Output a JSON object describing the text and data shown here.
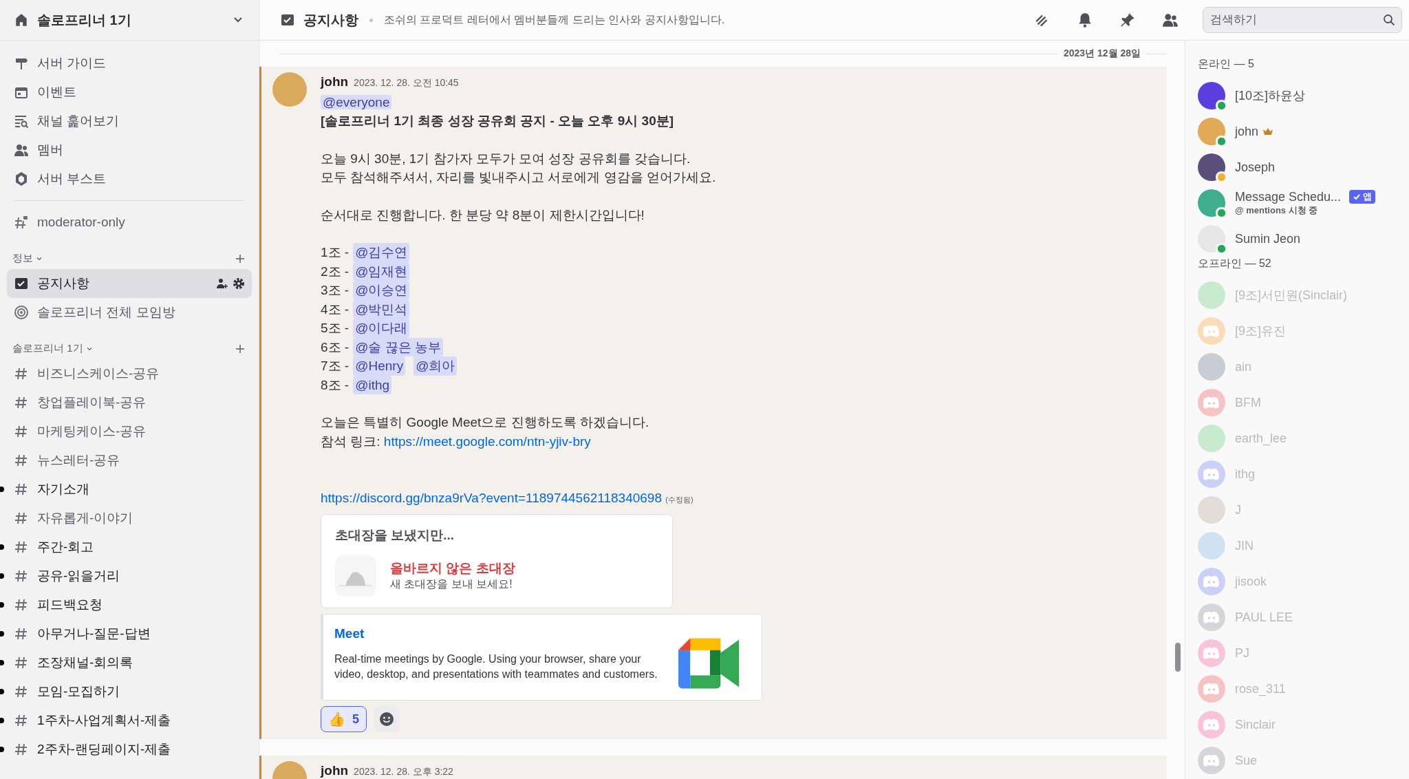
{
  "server": {
    "name": "솔로프리너 1기"
  },
  "nav_items": [
    {
      "label": "서버 가이드",
      "kind": "guide"
    },
    {
      "label": "이벤트",
      "kind": "event"
    },
    {
      "label": "채널 훑어보기",
      "kind": "browse"
    },
    {
      "label": "멤버",
      "kind": "members"
    },
    {
      "label": "서버 부스트",
      "kind": "boost"
    }
  ],
  "standalone_channels": [
    {
      "name": "moderator-only",
      "kind": "locked",
      "selected": false,
      "unread": false
    }
  ],
  "categories": [
    {
      "name": "정보",
      "channels": [
        {
          "name": "공지사항",
          "kind": "announcement",
          "selected": true,
          "unread": false
        },
        {
          "name": "솔로프리너 전체 모임방",
          "kind": "stage",
          "selected": false,
          "unread": false
        }
      ]
    },
    {
      "name": "솔로프리너 1기",
      "channels": [
        {
          "name": "비즈니스케이스-공유",
          "kind": "text",
          "selected": false,
          "unread": false
        },
        {
          "name": "창업플레이북-공유",
          "kind": "text",
          "selected": false,
          "unread": false
        },
        {
          "name": "마케팅케이스-공유",
          "kind": "text",
          "selected": false,
          "unread": false
        },
        {
          "name": "뉴스레터-공유",
          "kind": "text",
          "selected": false,
          "unread": false
        },
        {
          "name": "자기소개",
          "kind": "text",
          "selected": false,
          "unread": true
        },
        {
          "name": "자유롭게-이야기",
          "kind": "text",
          "selected": false,
          "unread": false
        },
        {
          "name": "주간-회고",
          "kind": "text",
          "selected": false,
          "unread": true
        },
        {
          "name": "공유-읽을거리",
          "kind": "text",
          "selected": false,
          "unread": true
        },
        {
          "name": "피드백요청",
          "kind": "text",
          "selected": false,
          "unread": true
        },
        {
          "name": "아무거나-질문-답변",
          "kind": "text",
          "selected": false,
          "unread": true
        },
        {
          "name": "조장채널-회의록",
          "kind": "text",
          "selected": false,
          "unread": true
        },
        {
          "name": "모임-모집하기",
          "kind": "text",
          "selected": false,
          "unread": true
        },
        {
          "name": "1주차-사업계획서-제출",
          "kind": "text",
          "selected": false,
          "unread": true
        },
        {
          "name": "2주차-랜딩페이지-제출",
          "kind": "text",
          "selected": false,
          "unread": true
        }
      ]
    }
  ],
  "header": {
    "channel": "공지사항",
    "topic": "조쉬의 프로덕트 레터에서 멤버분들께 드리는 인사와 공지사항입니다.",
    "search_placeholder": "검색하기"
  },
  "date_divider": "2023년 12월 28일",
  "messages": [
    {
      "author": "john",
      "time": "2023. 12. 28. 오전 10:45",
      "mentioned": true,
      "blocks": [
        {
          "kind": "mention",
          "text": "@everyone"
        },
        {
          "kind": "heading",
          "text": "[솔로프리너 1기 최종 성장 공유회 공지 - 오늘 오후 9시 30분]"
        },
        {
          "kind": "paragraph",
          "lines": [
            "오늘 9시 30분, 1기 참가자 모두가 모여 성장 공유회를 갖습니다.",
            "모두 참석해주셔서, 자리를 빛내주시고 서로에게 영감을 얻어가세요."
          ]
        },
        {
          "kind": "paragraph",
          "lines": [
            "순서대로 진행합니다. 한 분당 약 8분이 제한시간입니다!"
          ]
        },
        {
          "kind": "teams",
          "items": [
            {
              "label": "1조 -",
              "mentions": [
                "@김수연"
              ]
            },
            {
              "label": "2조 -",
              "mentions": [
                "@임재현"
              ]
            },
            {
              "label": "3조 -",
              "mentions": [
                "@이승연"
              ]
            },
            {
              "label": "4조 -",
              "mentions": [
                "@박민석"
              ]
            },
            {
              "label": "5조 -",
              "mentions": [
                "@이다래"
              ]
            },
            {
              "label": "6조 -",
              "mentions": [
                "@술 끊은 농부"
              ]
            },
            {
              "label": "7조 -",
              "mentions": [
                "@Henry",
                "@희아"
              ]
            },
            {
              "label": "8조 -",
              "mentions": [
                "@ithg"
              ]
            }
          ]
        },
        {
          "kind": "paragraph",
          "lines": [
            "오늘은 특별히 Google Meet으로 진행하도록 하겠습니다."
          ]
        },
        {
          "kind": "link-line",
          "prefix": "참석 링크:",
          "link": "https://meet.google.com/ntn-yjiv-bry"
        },
        {
          "kind": "link",
          "text": "https://discord.gg/bnza9rVa?event=1189744562118340698",
          "edited": "(수정됨)"
        }
      ],
      "invite": {
        "title": "초대장을 보냈지만...",
        "error": "올바르지 않은 초대장",
        "hint": "새 초대장을 보내 보세요!"
      },
      "embed": {
        "title": "Meet",
        "description": "Real-time meetings by Google. Using your browser, share your video, desktop, and presentations with teammates and customers."
      },
      "reactions": [
        {
          "emoji": "👍",
          "count": "5",
          "selected": true
        }
      ]
    },
    {
      "author": "john",
      "time": "2023. 12. 28. 오후 3:22",
      "mentioned": true
    }
  ],
  "member_sections": [
    {
      "title": "온라인 — 5",
      "offline": false,
      "members": [
        {
          "name": "[10조]하윤상",
          "kind": "photo",
          "color": "#5b3ee0",
          "idle": false,
          "owner": false
        },
        {
          "name": "john",
          "kind": "photo",
          "color": "#e0a955",
          "idle": false,
          "owner": true
        },
        {
          "name": "Joseph",
          "kind": "photo",
          "color": "#5a4f7a",
          "idle": true,
          "owner": false
        },
        {
          "name": "Message Schedu...",
          "kind": "photo",
          "color": "#3fae8c",
          "idle": false,
          "owner": false,
          "app_tag": "앱",
          "subtitle": "@ mentions 시청 중"
        },
        {
          "name": "Sumin Jeon",
          "kind": "photo",
          "color": "#e6e6e6",
          "idle": false,
          "owner": false
        }
      ]
    },
    {
      "title": "오프라인 — 52",
      "offline": true,
      "members": [
        {
          "name": "[9조]서민원(Sinclair)",
          "kind": "photo",
          "color": "#c8ebd0"
        },
        {
          "name": "[9조]유진",
          "kind": "logo",
          "color": "#fbdcb8"
        },
        {
          "name": "ain",
          "kind": "photo",
          "color": "#c9ced6"
        },
        {
          "name": "BFM",
          "kind": "logo",
          "color": "#f7c2c2"
        },
        {
          "name": "earth_lee",
          "kind": "photo",
          "color": "#c8ebd0"
        },
        {
          "name": "ithg",
          "kind": "logo",
          "color": "#ccd0f7"
        },
        {
          "name": "J",
          "kind": "photo",
          "color": "#e2ddd8"
        },
        {
          "name": "JIN",
          "kind": "photo",
          "color": "#cfe3f2"
        },
        {
          "name": "jisook",
          "kind": "logo",
          "color": "#ccd0f7"
        },
        {
          "name": "PAUL LEE",
          "kind": "logo",
          "color": "#d4d6da"
        },
        {
          "name": "PJ",
          "kind": "logo",
          "color": "#f9c4da"
        },
        {
          "name": "rose_311",
          "kind": "logo",
          "color": "#f7c2c2"
        },
        {
          "name": "Sinclair",
          "kind": "logo",
          "color": "#f9c4da"
        },
        {
          "name": "Sue",
          "kind": "logo",
          "color": "#d4d6da"
        }
      ]
    }
  ]
}
